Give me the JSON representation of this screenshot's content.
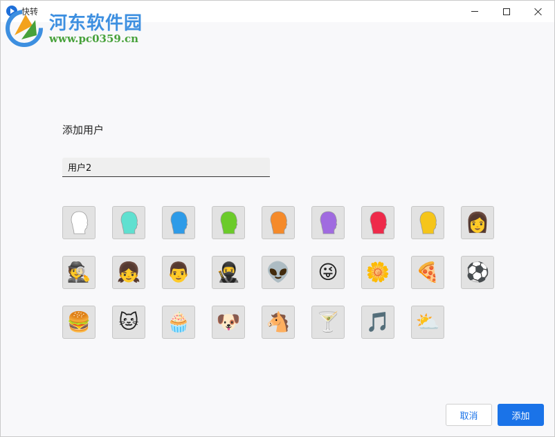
{
  "window": {
    "app_title": "快转",
    "colors": {
      "accent": "#1a73e8"
    }
  },
  "watermark": {
    "title": "河东软件园",
    "url": "www.pc0359.cn"
  },
  "main": {
    "heading": "添加用户",
    "name_input_value": "用户2"
  },
  "avatars": [
    {
      "kind": "silhouette",
      "color": "#ffffff",
      "name": "white-silhouette-avatar"
    },
    {
      "kind": "silhouette",
      "color": "#5fe0d0",
      "name": "teal-silhouette-avatar"
    },
    {
      "kind": "silhouette",
      "color": "#2e9be8",
      "name": "blue-silhouette-avatar"
    },
    {
      "kind": "silhouette",
      "color": "#6bcb2a",
      "name": "green-silhouette-avatar"
    },
    {
      "kind": "silhouette",
      "color": "#f58a2a",
      "name": "orange-silhouette-avatar"
    },
    {
      "kind": "silhouette",
      "color": "#a06be0",
      "name": "purple-silhouette-avatar"
    },
    {
      "kind": "silhouette",
      "color": "#ee2a4a",
      "name": "red-silhouette-avatar"
    },
    {
      "kind": "silhouette",
      "color": "#f5c51a",
      "name": "yellow-silhouette-avatar"
    },
    {
      "kind": "emoji",
      "glyph": "👩",
      "name": "woman-avatar"
    },
    {
      "kind": "emoji",
      "glyph": "🕵",
      "name": "sunglasses-man-avatar"
    },
    {
      "kind": "emoji",
      "glyph": "👧",
      "name": "girl-sunglasses-avatar"
    },
    {
      "kind": "emoji",
      "glyph": "👨",
      "name": "man-avatar"
    },
    {
      "kind": "emoji",
      "glyph": "🥷",
      "name": "ninja-avatar"
    },
    {
      "kind": "emoji",
      "glyph": "👽",
      "name": "alien-avatar"
    },
    {
      "kind": "emoji",
      "glyph": "😜",
      "name": "winking-face-avatar"
    },
    {
      "kind": "emoji",
      "glyph": "🌼",
      "name": "flower-avatar"
    },
    {
      "kind": "emoji",
      "glyph": "🍕",
      "name": "pizza-avatar"
    },
    {
      "kind": "emoji",
      "glyph": "⚽",
      "name": "soccer-ball-avatar"
    },
    {
      "kind": "emoji",
      "glyph": "🍔",
      "name": "burger-avatar"
    },
    {
      "kind": "emoji",
      "glyph": "🐱",
      "name": "cat-avatar"
    },
    {
      "kind": "emoji",
      "glyph": "🧁",
      "name": "cupcake-avatar"
    },
    {
      "kind": "emoji",
      "glyph": "🐶",
      "name": "dog-avatar"
    },
    {
      "kind": "emoji",
      "glyph": "🐴",
      "name": "horse-avatar"
    },
    {
      "kind": "emoji",
      "glyph": "🍸",
      "name": "cocktail-avatar"
    },
    {
      "kind": "emoji",
      "glyph": "🎵",
      "name": "music-note-avatar"
    },
    {
      "kind": "emoji",
      "glyph": "⛅",
      "name": "cloud-sun-avatar"
    }
  ],
  "footer": {
    "cancel_label": "取消",
    "add_label": "添加"
  }
}
